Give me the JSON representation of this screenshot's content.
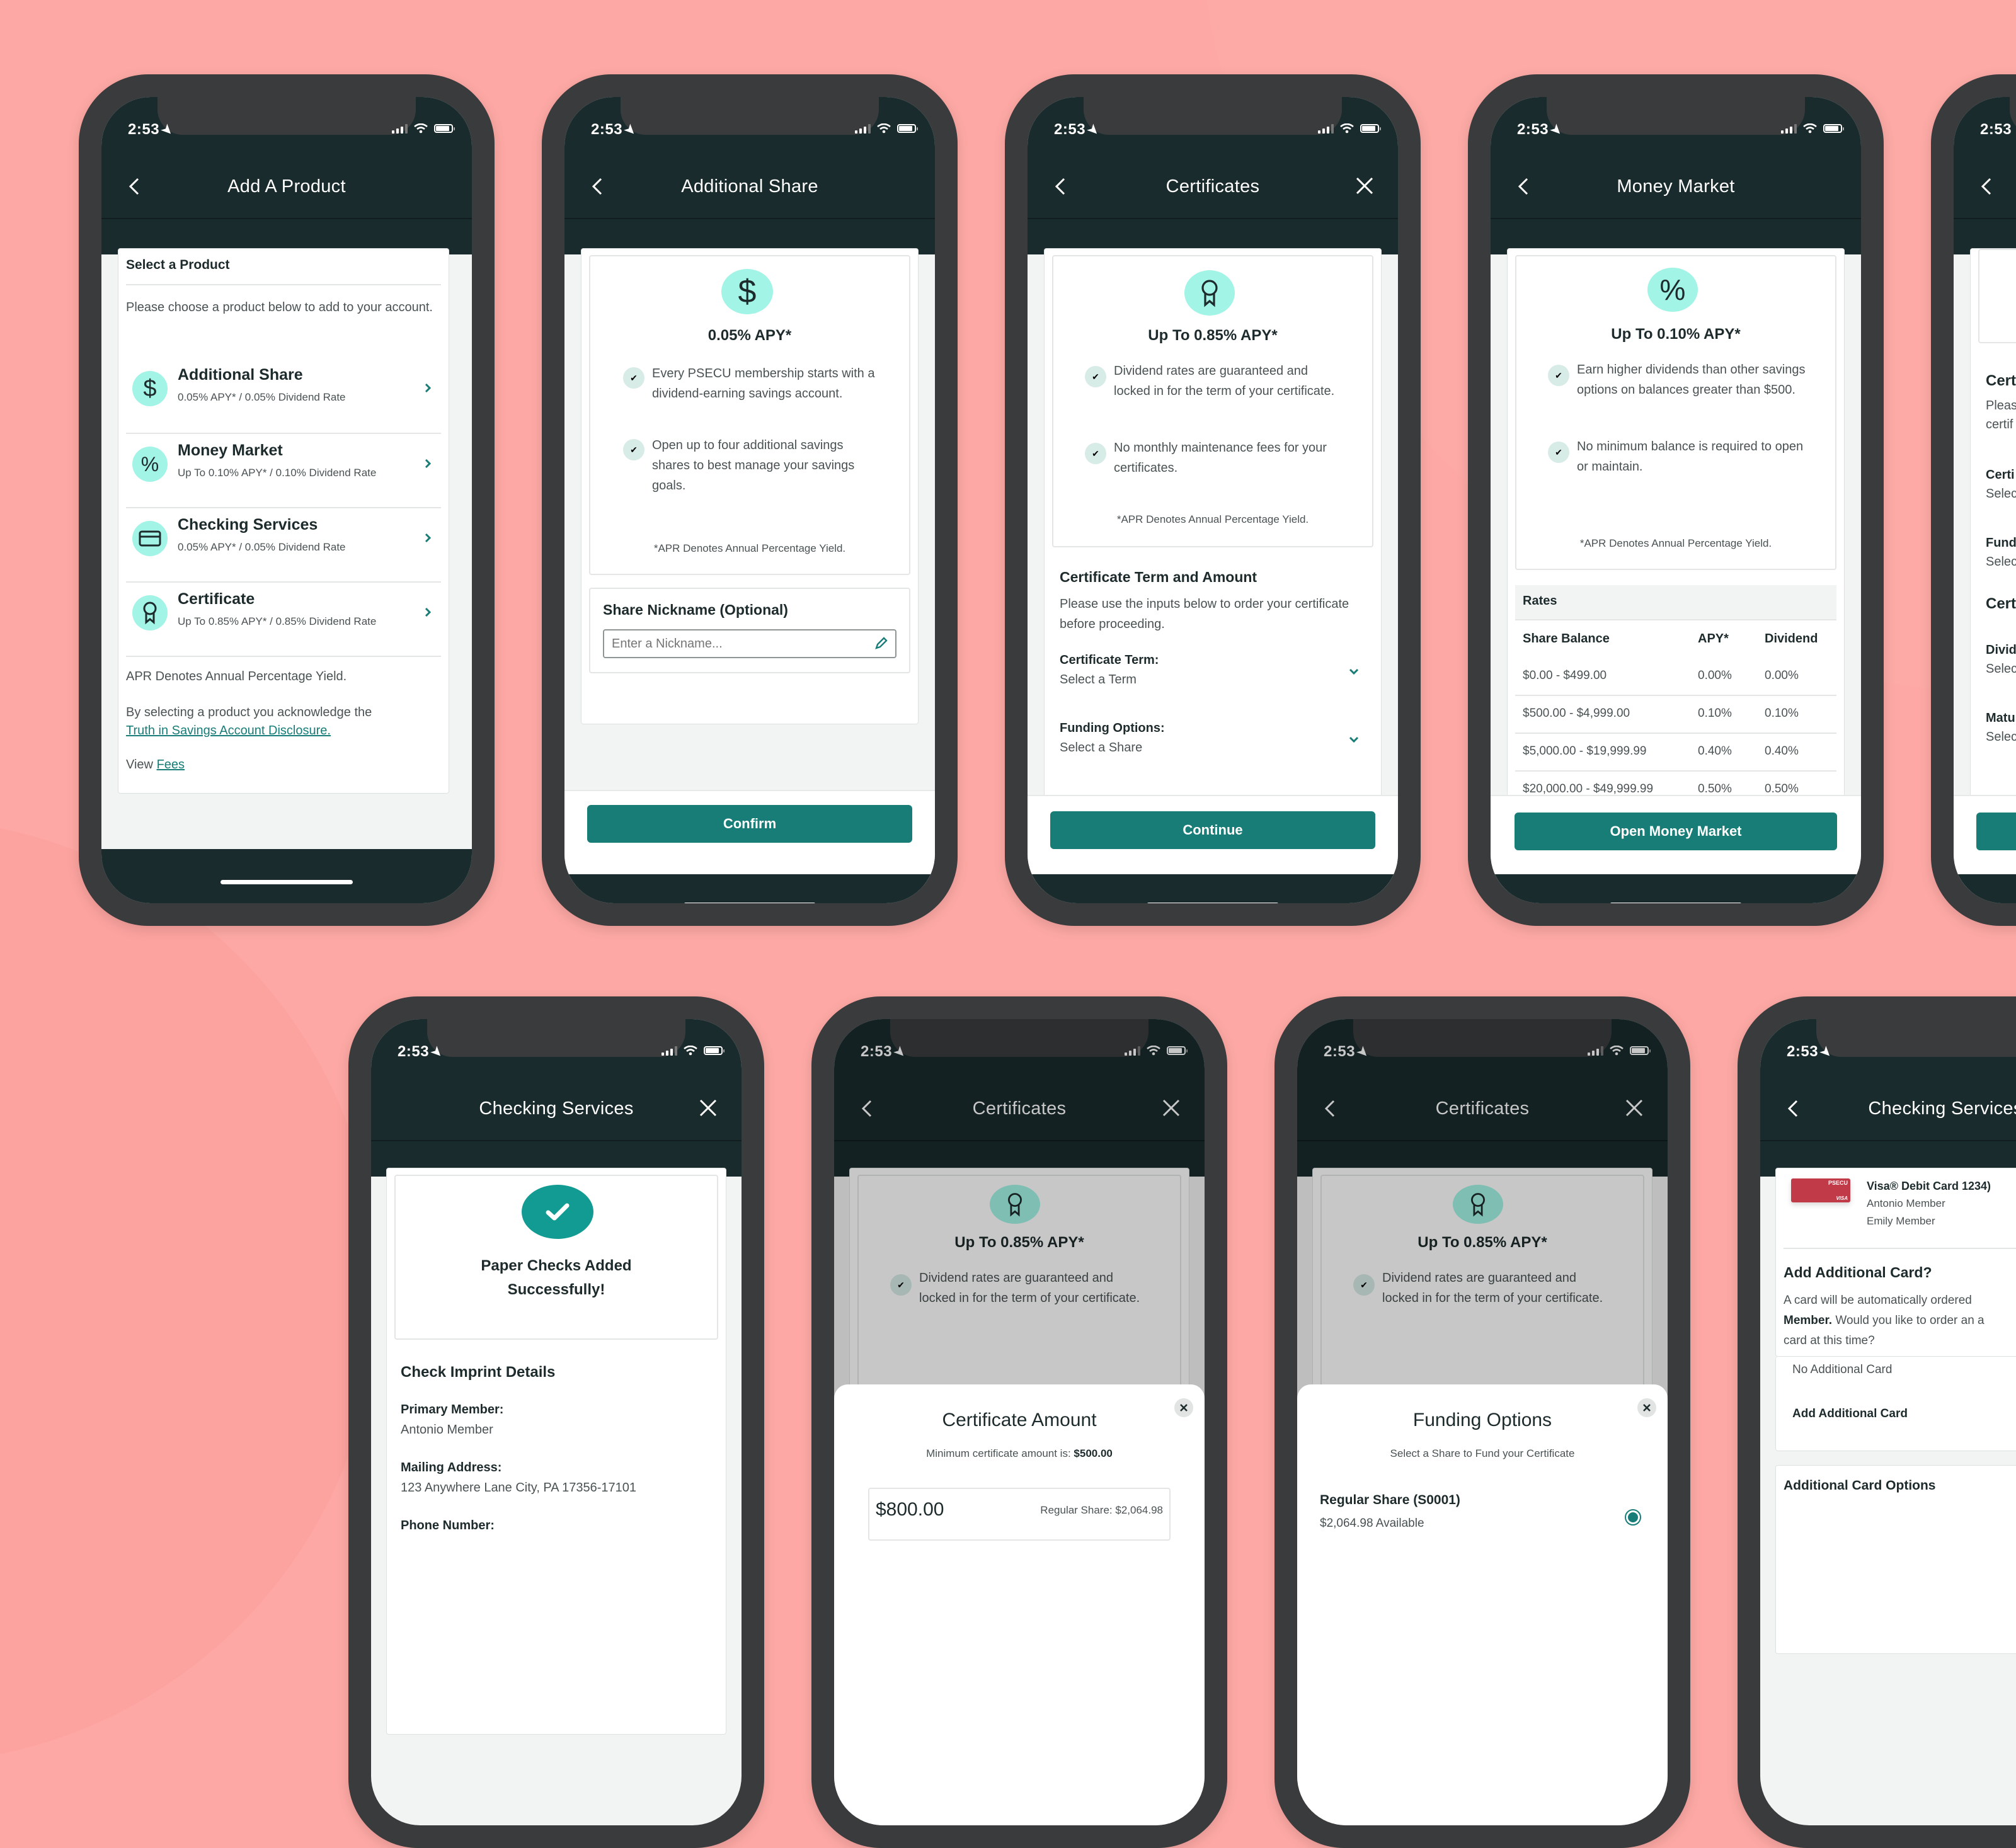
{
  "status_bar": {
    "time": "2:53"
  },
  "colors": {
    "background": "#fda8a4",
    "header": "#1a2b2d",
    "accent": "#187d77",
    "icon_mint": "#a2f4e6",
    "phone_frame": "#3a3b3d"
  },
  "screens": {
    "add_product": {
      "title": "Add A Product",
      "section_title": "Select a Product",
      "intro": "Please choose a product below to add to your account.",
      "products": [
        {
          "icon": "dollar-icon",
          "name": "Additional Share",
          "rate": "0.05% APY* / 0.05% Dividend Rate"
        },
        {
          "icon": "percent-icon",
          "name": "Money Market",
          "rate": "Up To 0.10% APY* / 0.10% Dividend Rate"
        },
        {
          "icon": "card-icon",
          "name": "Checking Services",
          "rate": "0.05% APY* / 0.05% Dividend Rate"
        },
        {
          "icon": "award-icon",
          "name": "Certificate",
          "rate": "Up To 0.85% APY* / 0.85% Dividend Rate"
        }
      ],
      "apr_note": "APR Denotes Annual Percentage Yield.",
      "ack_text": "By selecting a product you acknowledge the",
      "ack_link": "Truth in Savings Account Disclosure.",
      "view_label": "View",
      "fees_link": "Fees"
    },
    "additional_share": {
      "title": "Additional Share",
      "apy": "0.05% APY*",
      "benefits": [
        "Every PSECU membership starts with a dividend-earning savings account.",
        "Open up to four additional savings shares to best manage your savings goals."
      ],
      "footnote": "*APR Denotes Annual Percentage Yield.",
      "nickname_label": "Share Nickname (Optional)",
      "nickname_placeholder": "Enter a Nickname...",
      "nickname_value": "",
      "confirm_label": "Confirm"
    },
    "certificates": {
      "title": "Certificates",
      "apy": "Up To 0.85% APY*",
      "benefits": [
        "Dividend rates are guaranteed and locked in for the term of your certificate.",
        "No monthly maintenance fees for your certificates."
      ],
      "footnote": "*APR Denotes Annual Percentage Yield.",
      "section_title": "Certificate Term and Amount",
      "section_desc": "Please use the inputs below to order your certificate before proceeding.",
      "term_label": "Certificate Term:",
      "term_value": "Select a Term",
      "funding_label": "Funding Options:",
      "funding_value": "Select a Share",
      "continue_label": "Continue"
    },
    "money_market": {
      "title": "Money Market",
      "apy": "Up To 0.10% APY*",
      "benefits": [
        "Earn higher dividends than other savings options on balances greater than $500.",
        "No minimum balance is required to open or maintain."
      ],
      "footnote": "*APR Denotes Annual Percentage Yield.",
      "rates_title": "Rates",
      "columns": [
        "Share Balance",
        "APY*",
        "Dividend"
      ],
      "rows": [
        [
          "$0.00 - $499.00",
          "0.00%",
          "0.00%"
        ],
        [
          "$500.00 - $4,999.00",
          "0.10%",
          "0.10%"
        ],
        [
          "$5,000.00 - $19,999.99",
          "0.40%",
          "0.40%"
        ],
        [
          "$20,000.00 - $49,999.99",
          "0.50%",
          "0.50%"
        ]
      ],
      "open_label": "Open Money Market"
    },
    "certificates_partial": {
      "labels": [
        "Cert",
        "Pleas",
        "certif",
        "Certi",
        "Selec",
        "Fund",
        "Selec",
        "Cert",
        "Divid",
        "Selec",
        "Matu",
        "Selec"
      ]
    },
    "checking_success": {
      "title": "Checking Services",
      "success_line1": "Paper Checks Added",
      "success_line2": "Successfully!",
      "section_title": "Check Imprint Details",
      "primary_label": "Primary Member:",
      "primary_value": "Antonio Member",
      "address_label": "Mailing Address:",
      "address_value": "123 Anywhere Lane City, PA 17356-17101",
      "phone_label": "Phone Number:"
    },
    "cert_amount": {
      "title": "Certificates",
      "apy": "Up To 0.85% APY*",
      "benefit": "Dividend rates are guaranteed and locked in for the term of your certificate.",
      "sheet_title": "Certificate Amount",
      "min_text": "Minimum certificate amount is:",
      "min_value": "$500.00",
      "amount_value": "$800.00",
      "source_label": "Regular Share: $2,064.98"
    },
    "funding_options": {
      "title": "Certificates",
      "apy": "Up To 0.85% APY*",
      "benefit": "Dividend rates are guaranteed and locked in for the term of your certificate.",
      "sheet_title": "Funding Options",
      "sheet_subtitle": "Select a Share to Fund your Certificate",
      "option_name": "Regular Share (S0001)",
      "option_available": "$2,064.98 Available",
      "option_selected": true
    },
    "checking_card": {
      "title": "Checking Services",
      "card_brand": "PSECU",
      "card_network": "VISA",
      "card_name": "Visa® Debit Card 1234)",
      "holder1": "Antonio Member",
      "holder2": "Emily Member",
      "add_title": "Add Additional Card?",
      "add_desc_1": "A card will be automatically ordered",
      "add_desc_bold": "Member.",
      "add_desc_2": "Would you like to order an a",
      "add_desc_3": "card at this time?",
      "option_no": "No Additional Card",
      "option_add": "Add Additional Card",
      "options_title": "Additional Card Options"
    }
  }
}
